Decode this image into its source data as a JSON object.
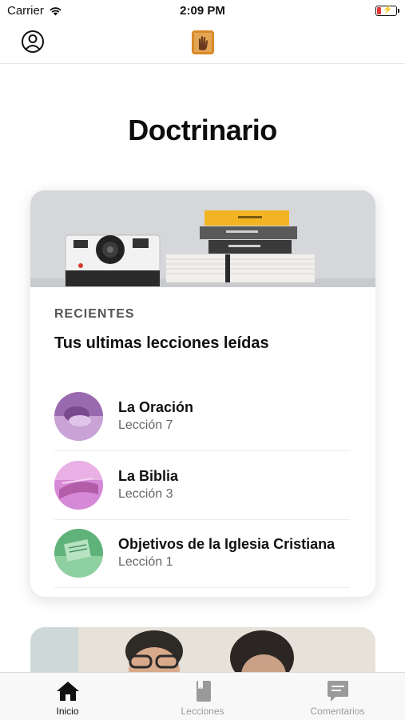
{
  "status_bar": {
    "carrier": "Carrier",
    "time": "2:09 PM"
  },
  "nav": {
    "profile_icon": "person-circle-icon",
    "logo_icon": "app-logo-icon"
  },
  "page": {
    "title": "Doctrinario"
  },
  "recent_card": {
    "label": "RECIENTES",
    "heading": "Tus ultimas lecciones leídas",
    "lessons": [
      {
        "title": "La Oración",
        "subtitle": "Lección 7"
      },
      {
        "title": "La Biblia",
        "subtitle": "Lección 3"
      },
      {
        "title": "Objetivos de la Iglesia Cristiana",
        "subtitle": "Lección 1"
      }
    ]
  },
  "tabs": [
    {
      "label": "Inicio",
      "icon": "home-icon",
      "active": true
    },
    {
      "label": "Lecciones",
      "icon": "book-icon",
      "active": false
    },
    {
      "label": "Comentarios",
      "icon": "comment-icon",
      "active": false
    }
  ],
  "colors": {
    "active_tab": "#111111",
    "inactive_tab": "#9a9a9a",
    "battery_low": "#e53935"
  }
}
